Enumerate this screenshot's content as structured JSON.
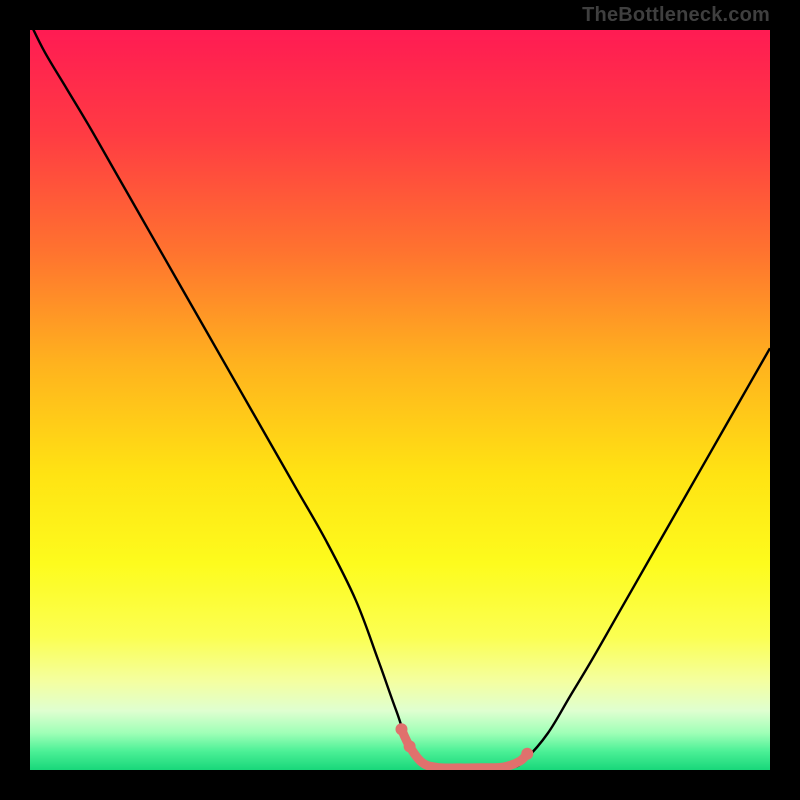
{
  "watermark": {
    "text": "TheBottleneck.com"
  },
  "gradient_stops": [
    {
      "pct": 0,
      "color": "#ff1b53"
    },
    {
      "pct": 14,
      "color": "#ff3b43"
    },
    {
      "pct": 30,
      "color": "#ff732f"
    },
    {
      "pct": 45,
      "color": "#ffb21e"
    },
    {
      "pct": 60,
      "color": "#ffe313"
    },
    {
      "pct": 72,
      "color": "#fdfb1d"
    },
    {
      "pct": 82,
      "color": "#fbff52"
    },
    {
      "pct": 88,
      "color": "#f4ffa0"
    },
    {
      "pct": 92,
      "color": "#dfffd0"
    },
    {
      "pct": 95,
      "color": "#9fffb7"
    },
    {
      "pct": 97.5,
      "color": "#4bf096"
    },
    {
      "pct": 100,
      "color": "#18d77a"
    }
  ],
  "chart_data": {
    "type": "line",
    "title": "",
    "xlabel": "",
    "ylabel": "",
    "xlim": [
      0,
      100
    ],
    "ylim": [
      0,
      100
    ],
    "series": [
      {
        "name": "bottleneck-curve",
        "color": "#000000",
        "width": 2.4,
        "x": [
          0,
          2,
          5,
          8,
          12,
          16,
          20,
          24,
          28,
          32,
          36,
          40,
          44,
          47,
          49.5,
          51.5,
          55,
          60,
          65,
          67,
          70,
          73,
          76,
          80,
          84,
          88,
          92,
          96,
          100
        ],
        "y": [
          101,
          97,
          92,
          87,
          80,
          73,
          66,
          59,
          52,
          45,
          38,
          31,
          23,
          15,
          8,
          3,
          0.3,
          0.2,
          0.3,
          1.5,
          5,
          10,
          15,
          22,
          29,
          36,
          43,
          50,
          57
        ]
      },
      {
        "name": "highlight-segment",
        "color": "#e0716d",
        "width": 9,
        "linecap": "round",
        "dot_indices": [
          0,
          1,
          8
        ],
        "dot_radius": 6,
        "x": [
          50.2,
          51.3,
          53,
          55,
          58,
          61,
          64,
          66.2,
          67.2
        ],
        "y": [
          5.5,
          3.2,
          1.0,
          0.35,
          0.28,
          0.3,
          0.4,
          1.2,
          2.2
        ]
      }
    ]
  }
}
